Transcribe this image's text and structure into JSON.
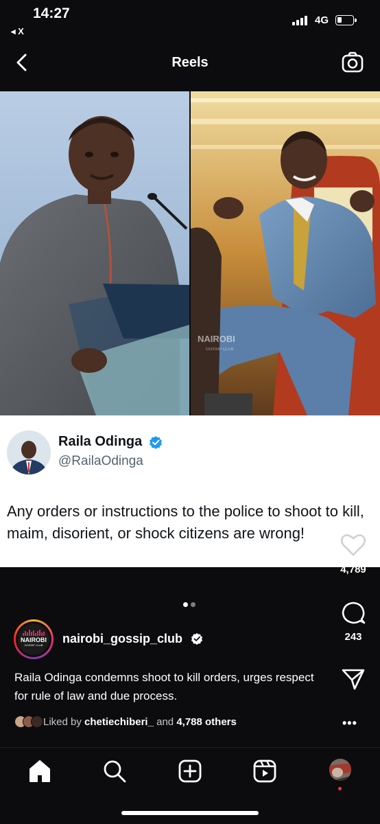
{
  "status_bar": {
    "time": "14:27",
    "back_app": "◂ X",
    "network": "4G",
    "signal_bars": 4,
    "battery_level": 0.2
  },
  "header": {
    "title": "Reels",
    "back_icon": "chevron-left-icon",
    "camera_icon": "camera-icon"
  },
  "media": {
    "watermark": "NAIROBI",
    "watermark_sub": "GOSSIP CLUB",
    "tweet": {
      "name": "Raila Odinga",
      "handle": "@RailaOdinga",
      "verified": true,
      "text": "Any orders or instructions to the police to shoot to kill, maim, disorient, or shock citizens are wrong!"
    }
  },
  "actions": {
    "like_count": "4,789",
    "comment_count": "243",
    "like_icon": "heart-icon",
    "comment_icon": "comment-icon",
    "share_icon": "send-icon",
    "more_icon": "more-icon"
  },
  "carousel": {
    "total": 2,
    "current": 1
  },
  "post": {
    "account_name": "nairobi_gossip_club",
    "account_verified": true,
    "avatar_text": "NAIROBI",
    "avatar_subtext": "GOSSIP CLUB",
    "caption": "Raila Odinga condemns shoot to kill orders, urges respect for rule of law and due process.",
    "liked_prefix": "Liked by",
    "liked_user": "chetiechiberi_",
    "liked_and": "and",
    "liked_others": "4,788 others",
    "more_label": "•••"
  },
  "bottom_nav": {
    "items": [
      "home-icon",
      "search-icon",
      "create-icon",
      "reels-icon",
      "profile-avatar"
    ],
    "active": "home-icon"
  },
  "colors": {
    "background": "#0c0c0e",
    "verified_blue": "#1d9bf0",
    "notification_red": "#ff3040"
  }
}
